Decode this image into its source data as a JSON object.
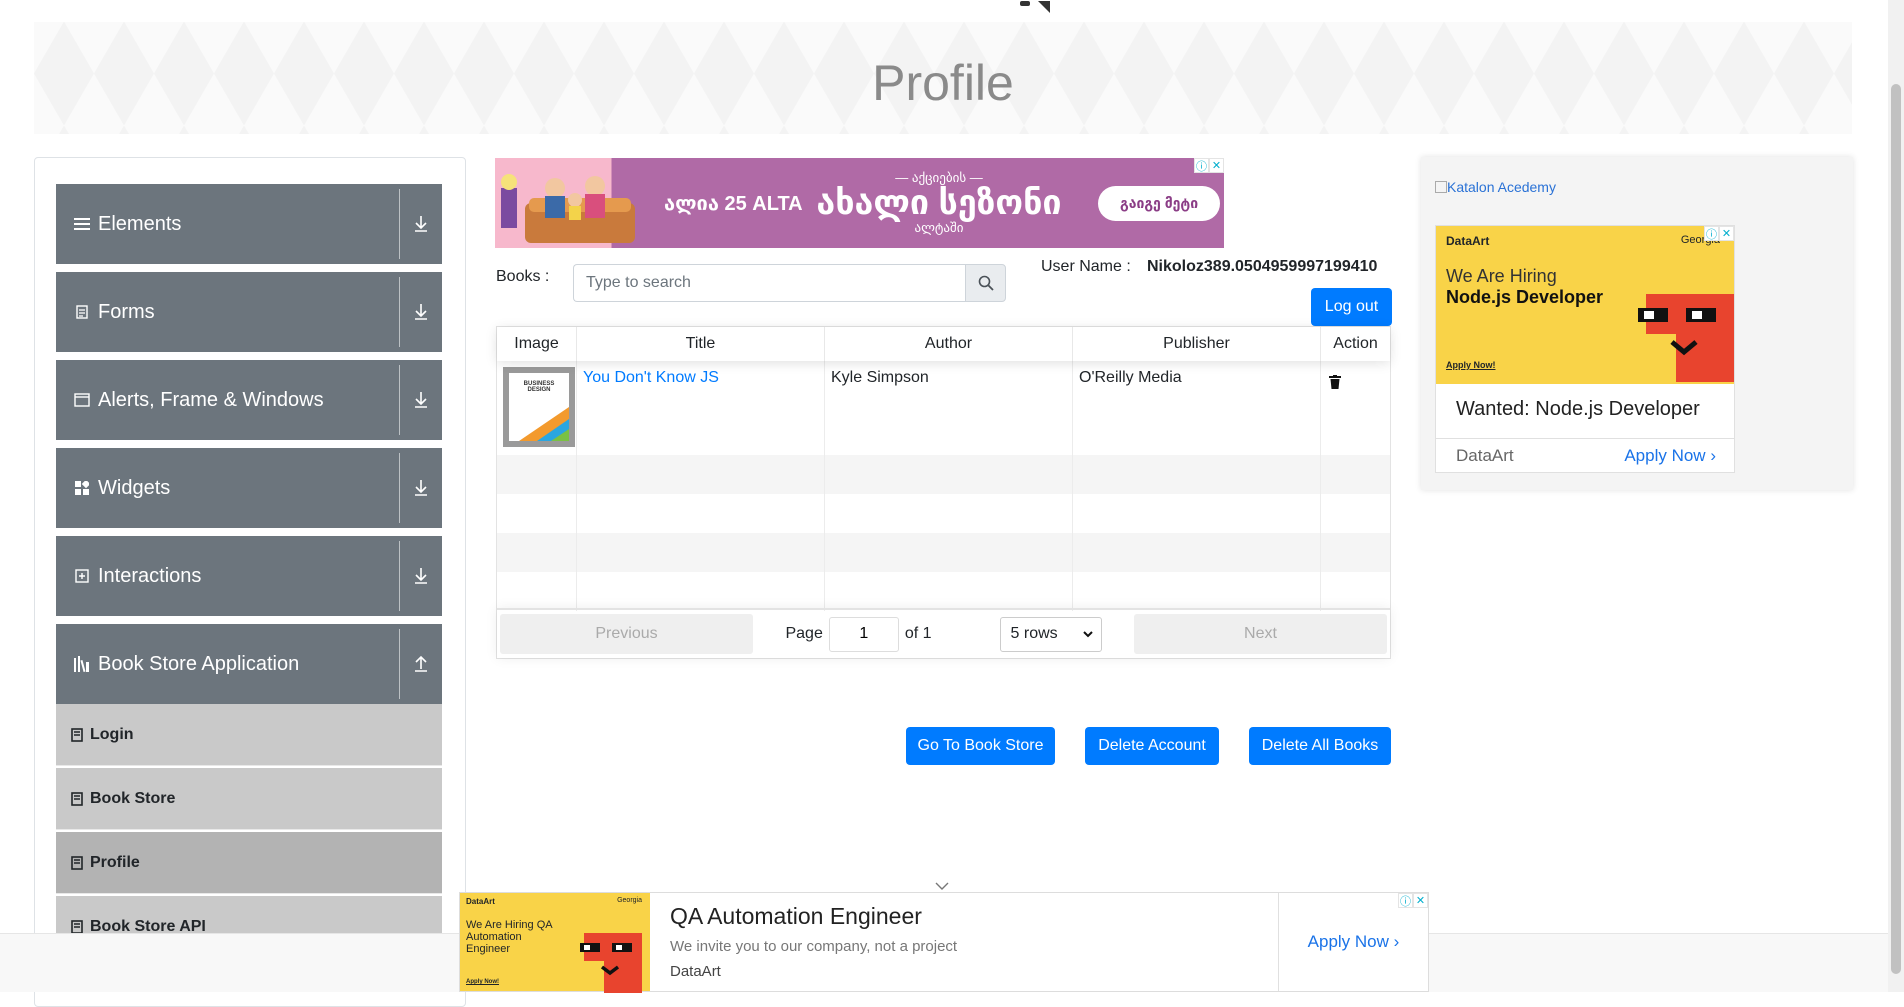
{
  "page": {
    "title": "Profile"
  },
  "sidebar": {
    "groups": [
      {
        "label": "Elements",
        "icon": "hamburger-icon",
        "expanded": false
      },
      {
        "label": "Forms",
        "icon": "form-icon",
        "expanded": false
      },
      {
        "label": "Alerts, Frame & Windows",
        "icon": "window-icon",
        "expanded": false
      },
      {
        "label": "Widgets",
        "icon": "widgets-icon",
        "expanded": false
      },
      {
        "label": "Interactions",
        "icon": "interactions-icon",
        "expanded": false
      },
      {
        "label": "Book Store Application",
        "icon": "books-icon",
        "expanded": true
      }
    ],
    "bookstore_items": [
      "Login",
      "Book Store",
      "Profile",
      "Book Store API"
    ],
    "active_item": "Profile"
  },
  "ad_top": {
    "brand": "ალია 25 ALTA",
    "headline_top": "— აქციების —",
    "headline": "ახალი სეზონი",
    "headline_sub": "ალტაში",
    "cta": "გაიგე მეტი"
  },
  "books": {
    "label": "Books :",
    "search_placeholder": "Type to search",
    "search_value": ""
  },
  "user": {
    "label": "User Name :",
    "value": "Nikoloz389.0504959997199410",
    "logout": "Log out"
  },
  "table": {
    "columns": [
      "Image",
      "Title",
      "Author",
      "Publisher",
      "Action"
    ],
    "rows": [
      {
        "cover_text": "BUSINESS DESIGN",
        "title": "You Don't Know JS",
        "author": "Kyle Simpson",
        "publisher": "O'Reilly Media"
      }
    ],
    "pagination": {
      "previous": "Previous",
      "page_label": "Page",
      "page_value": "1",
      "of_label": "of 1",
      "rows_option": "5 rows",
      "next": "Next"
    }
  },
  "actions": {
    "go_to_store": "Go To Book Store",
    "delete_account": "Delete Account",
    "delete_all_books": "Delete All Books"
  },
  "ad_right": {
    "katalon_alt": "Katalon Acedemy",
    "brand": "DataArt",
    "region": "Georgia",
    "hire_line1": "We Are Hiring",
    "hire_line2": "Node.js Developer",
    "small_apply": "Apply Now!",
    "job_title": "Wanted: Node.js Developer",
    "company": "DataArt",
    "apply": "Apply Now"
  },
  "ad_bottom": {
    "brand": "DataArt",
    "region": "Georgia",
    "hire_text": "We Are Hiring QA Automation Engineer",
    "tiny_apply": "Apply Now!",
    "title": "QA Automation Engineer",
    "subtitle": "We invite you to our company, not a project",
    "company": "DataArt",
    "apply": "Apply Now"
  },
  "colors": {
    "primary": "#007bff",
    "sidebar_group": "#6c757d",
    "sidebar_item": "#c9c9c9",
    "sidebar_item_active": "#b3b3b3",
    "link": "#007bff",
    "ad_yellow": "#f9d348"
  }
}
